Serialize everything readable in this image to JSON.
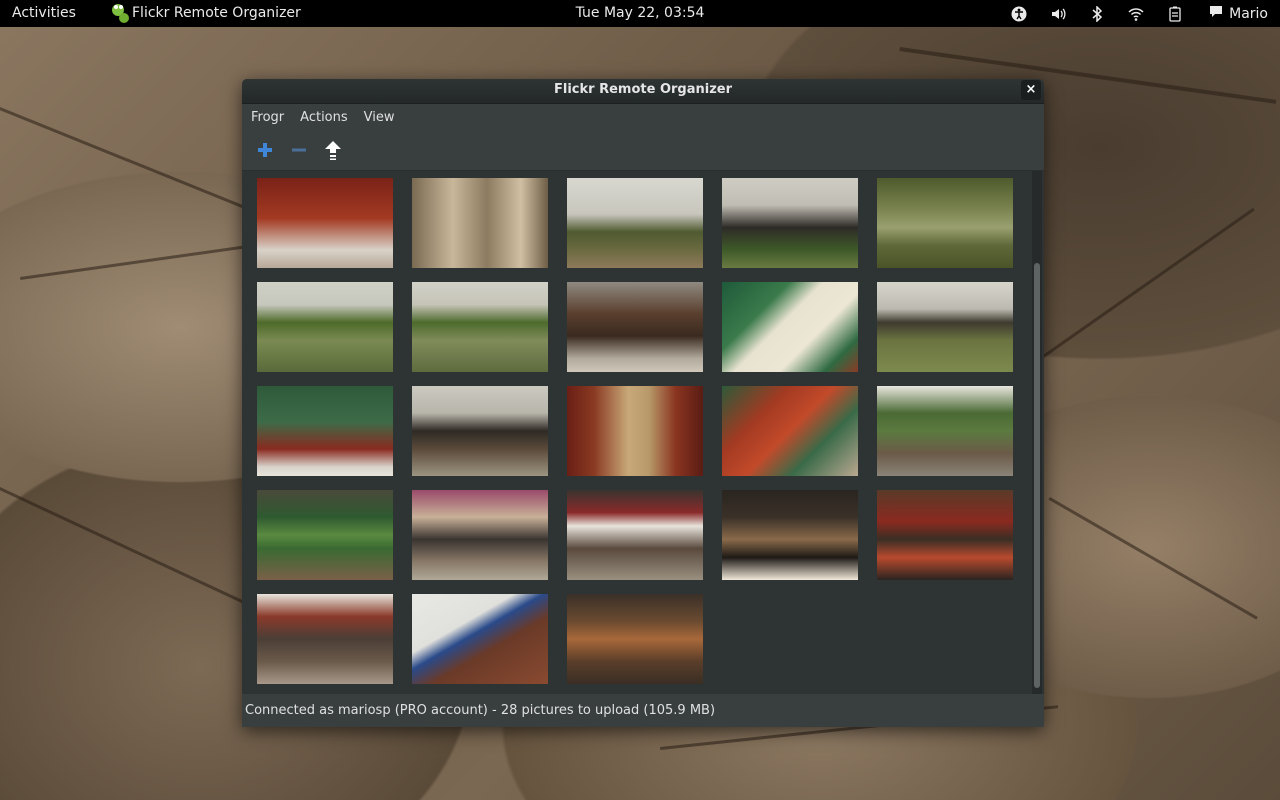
{
  "topbar": {
    "activities": "Activities",
    "app_name": "Flickr Remote Organizer",
    "clock": "Tue May 22, 03:54",
    "user": "Mario",
    "tray_icons": [
      "accessibility-icon",
      "volume-icon",
      "bluetooth-icon",
      "wifi-icon",
      "battery-icon",
      "chat-icon"
    ]
  },
  "window": {
    "title": "Flickr Remote Organizer",
    "close_label": "×",
    "menu": [
      "Frogr",
      "Actions",
      "View"
    ],
    "toolbar": [
      "add-icon",
      "remove-icon",
      "upload-icon"
    ],
    "status": "Connected as mariosp (PRO account) - 28 pictures to upload (105.9 MB)"
  },
  "colors": {
    "topbar_bg": "#000000",
    "window_bg": "#393f3f",
    "content_bg": "#2e3333",
    "add_icon": "#3f86d9",
    "remove_icon": "#4a6f98"
  },
  "thumbnails": [
    {
      "name": "palace-interior-red-pillars",
      "bg": "linear-gradient(180deg,#7a2218 0%,#a33a22 45%,#d8d2c8 80%,#b8a898 100%)"
    },
    {
      "name": "stone-pillar-bases",
      "bg": "linear-gradient(90deg,#7a6a52 0%,#c9b79a 30%,#8c7b60 55%,#d0bfa2 80%,#6e5e47 100%)"
    },
    {
      "name": "palace-pavilion-garden",
      "bg": "linear-gradient(180deg,#d8d8d0 0%,#c8c6bd 40%,#4f5a30 60%,#6b6a40 80%,#8e7a5a 100%)"
    },
    {
      "name": "pagoda-tower",
      "bg": "linear-gradient(180deg,#cfccc4 0%,#c0bdb4 30%,#2e2b27 55%,#3e5a28 80%,#6b7a42 100%)"
    },
    {
      "name": "pond-reflection",
      "bg": "linear-gradient(180deg,#4e5a2c 0%,#7b8450 35%,#9aa070 55%,#5e6838 75%,#4a5428 100%)"
    },
    {
      "name": "lotus-pond-bridge",
      "bg": "linear-gradient(180deg,#cfd0c6 0%,#c7c8bd 25%,#4e6a2a 45%,#7a8a52 65%,#5a6a3a 100%)"
    },
    {
      "name": "person-at-pond",
      "bg": "linear-gradient(180deg,#d2d1c8 0%,#c6c4b8 25%,#4d6a2c 45%,#808c5a 65%,#5e6b3e 100%)"
    },
    {
      "name": "clay-pots",
      "bg": "linear-gradient(180deg,#8f8a80 0%,#5a3f2e 35%,#3a2a20 60%,#b2aa9c 85%,#cfc8bb 100%)"
    },
    {
      "name": "gate-sign-plaque",
      "bg": "linear-gradient(135deg,#1e5a3a 0%,#3a7a4a 30%,#e8e2d0 45%,#ece6d4 65%,#2e6a42 85%,#8a3a26 100%)"
    },
    {
      "name": "pavilion-lake",
      "bg": "linear-gradient(180deg,#d6d5cc 0%,#bcbab0 30%,#3e3a30 45%,#6b7440 65%,#7d8a4e 100%)"
    },
    {
      "name": "woman-in-hanbok",
      "bg": "linear-gradient(180deg,#2e5a3a 0%,#3d6b48 40%,#8a2a20 70%,#d8d4cc 90%,#e8e4dc 100%)"
    },
    {
      "name": "throne-hall",
      "bg": "linear-gradient(180deg,#cbc9c0 0%,#b8b5ab 30%,#2e2a24 50%,#5b4a3a 70%,#9d9482 100%)"
    },
    {
      "name": "corridor-columns",
      "bg": "linear-gradient(90deg,#6a1f16 0%,#8a3a22 20%,#c8a878 45%,#b89a6a 60%,#8a3420 80%,#5a1c14 100%)"
    },
    {
      "name": "painted-eaves",
      "bg": "linear-gradient(135deg,#2e5a3a 0%,#a33a22 30%,#c24a2a 50%,#3a6a48 70%,#b8a890 100%)"
    },
    {
      "name": "busy-street-trees",
      "bg": "linear-gradient(180deg,#e8e6de 0%,#4a6a34 30%,#5b7a40 50%,#6b5a48 75%,#8a8478 100%)"
    },
    {
      "name": "shop-sign-green",
      "bg": "linear-gradient(180deg,#4a4a3a 0%,#2e5a30 30%,#5a8a40 50%,#3a6a32 65%,#7a6048 100%)"
    },
    {
      "name": "market-cart",
      "bg": "linear-gradient(180deg,#9a4a6a 0%,#c8b098 30%,#3a3430 55%,#8a7a68 80%,#b0a898 100%)"
    },
    {
      "name": "shopping-street",
      "bg": "linear-gradient(180deg,#3a3430 0%,#8a2a2a 25%,#e8e4dc 40%,#5a4a3e 65%,#9a9080 100%)"
    },
    {
      "name": "restaurant-front",
      "bg": "linear-gradient(180deg,#2a2520 0%,#3a3028 30%,#8a6a4a 55%,#1e1a16 75%,#f0e8d8 100%)"
    },
    {
      "name": "building-balconies",
      "bg": "linear-gradient(180deg,#5a3a28 0%,#8a2a20 35%,#3a2e24 55%,#b84a2e 75%,#2a2420 100%)"
    },
    {
      "name": "crowded-market",
      "bg": "linear-gradient(180deg,#e8e4dc 0%,#8a3a2a 25%,#4a3e36 50%,#6b5a4a 75%,#a8988a 100%)"
    },
    {
      "name": "street-sign-insadong",
      "bg": "linear-gradient(150deg,#e8e8e4 0%,#e0e0dc 35%,#2a4a8a 45%,#6a3a28 60%,#8a4a30 100%)"
    },
    {
      "name": "carved-wooden-sign",
      "bg": "linear-gradient(180deg,#3a3028 0%,#6a4a30 30%,#a8683a 50%,#5a3e2a 75%,#3a2e24 100%)"
    }
  ]
}
